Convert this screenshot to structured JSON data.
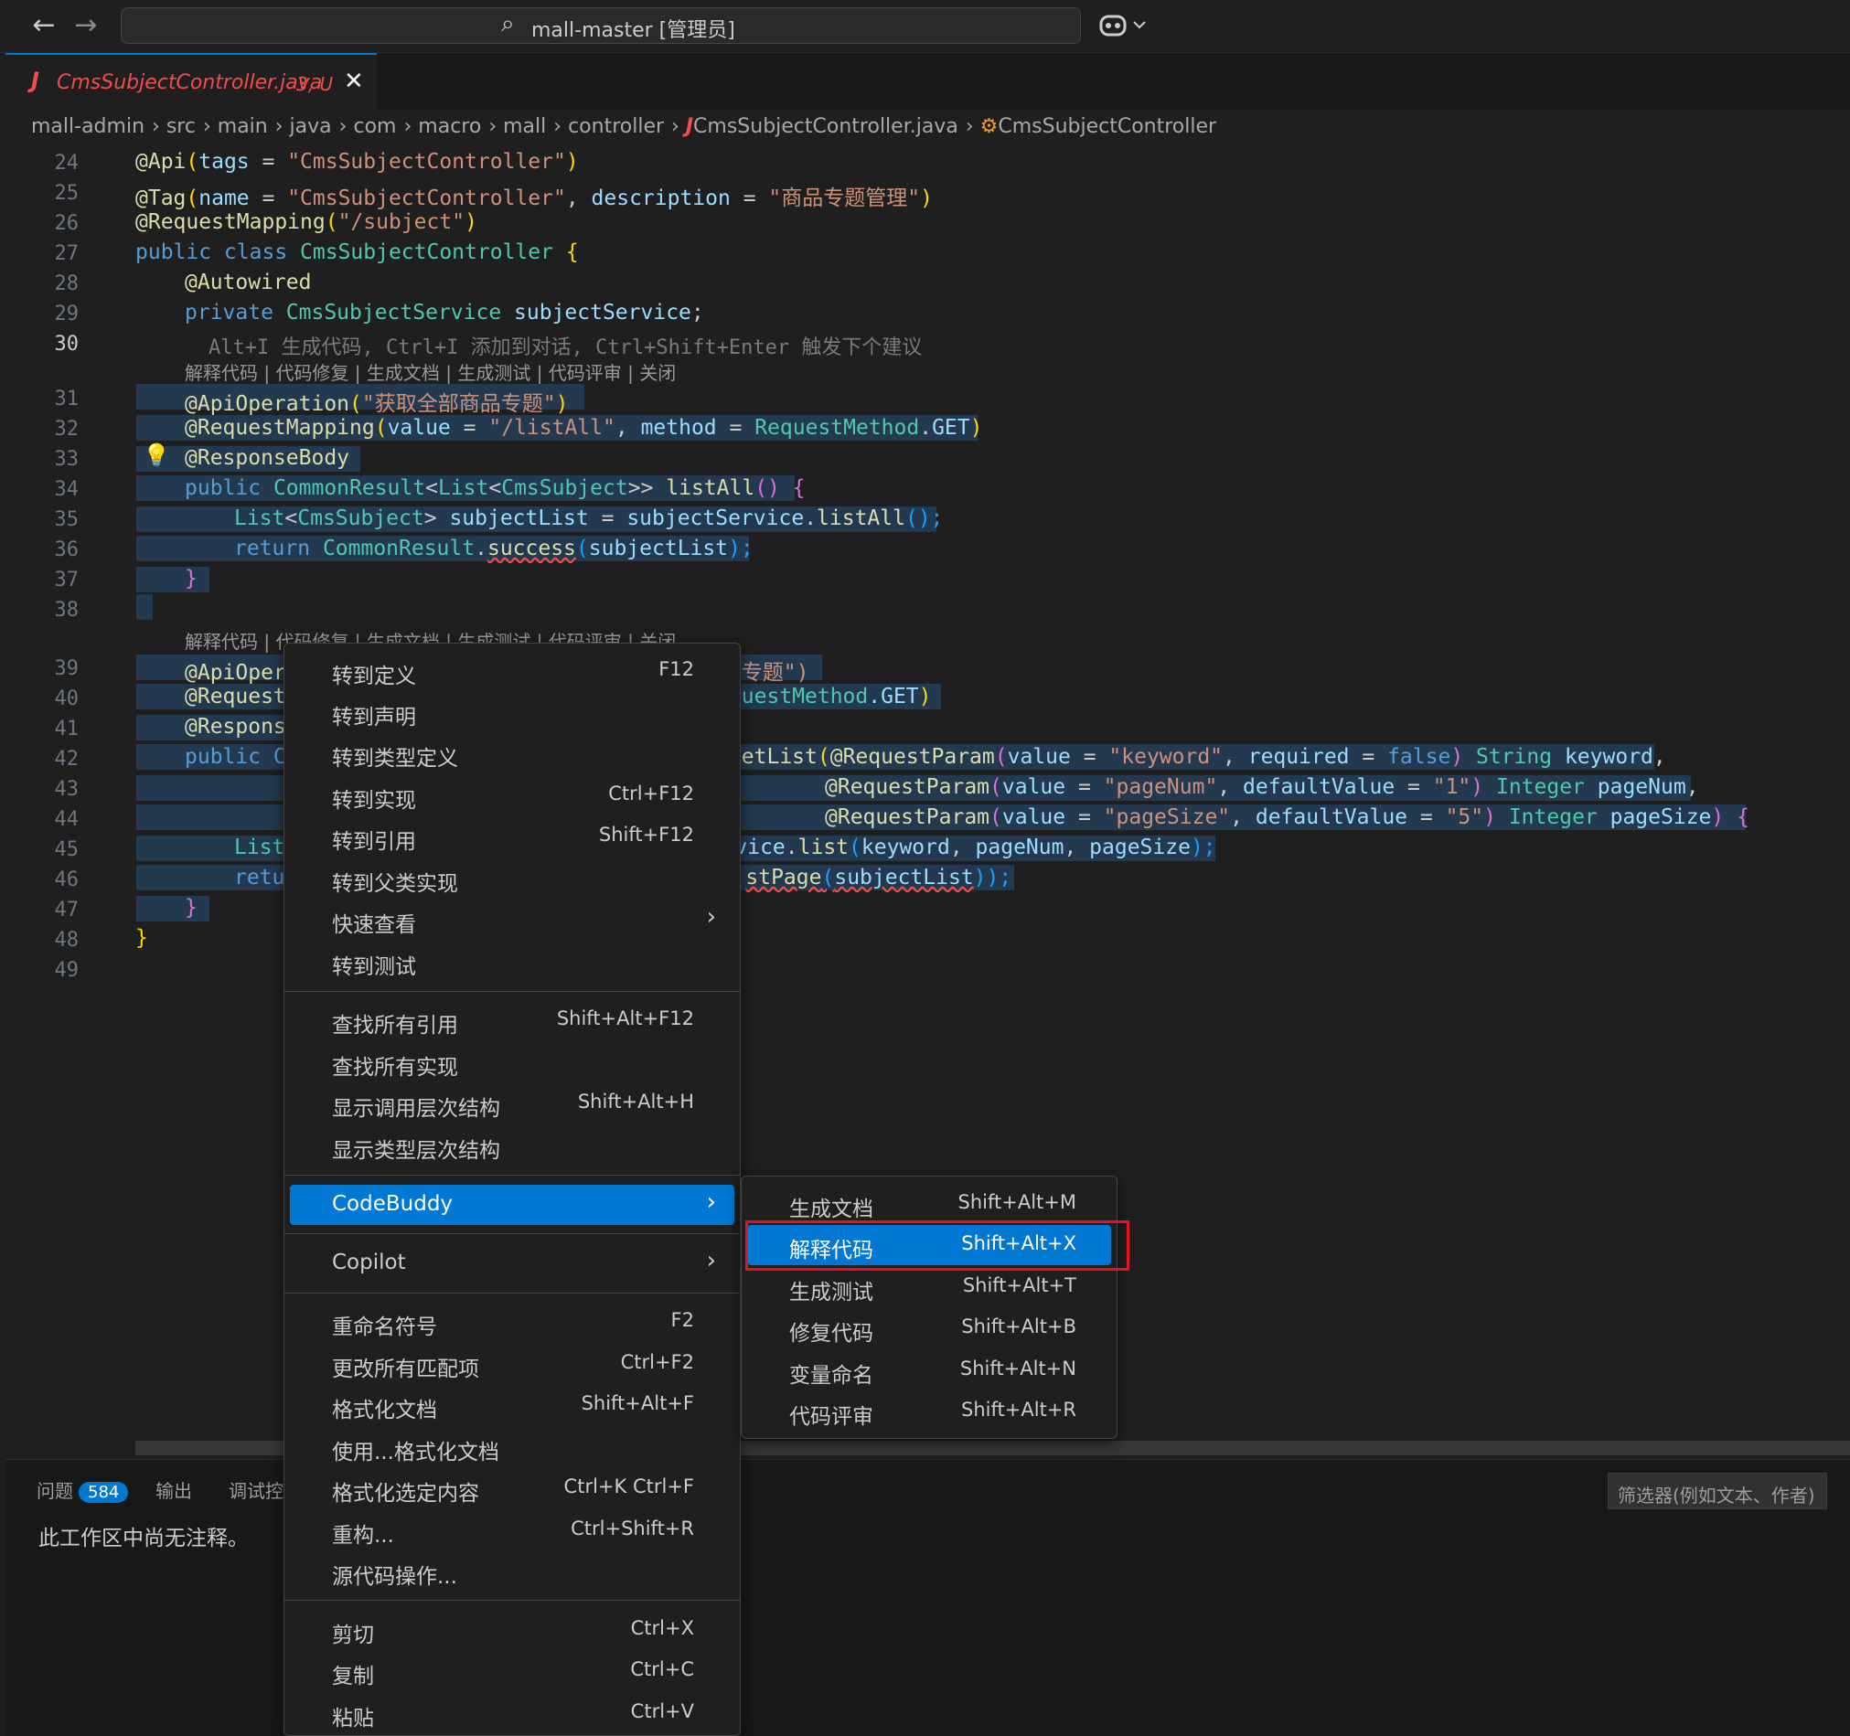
{
  "titlebar": {
    "back_icon": "←",
    "forward_icon": "→",
    "search_icon": "⌕",
    "title": "mall-master [管理员]",
    "copilot_icon": "copilot-icon"
  },
  "tab": {
    "icon": "J",
    "name": "CmsSubjectController.java",
    "status": "3, U",
    "close": "✕"
  },
  "breadcrumb": [
    "mall-admin",
    "src",
    "main",
    "java",
    "com",
    "macro",
    "mall",
    "controller",
    "CmsSubjectController.java",
    "CmsSubjectController"
  ],
  "gutter": [
    "24",
    "25",
    "26",
    "27",
    "28",
    "29",
    "30",
    "31",
    "32",
    "33",
    "34",
    "35",
    "36",
    "37",
    "38",
    "39",
    "40",
    "41",
    "42",
    "43",
    "44",
    "45",
    "46",
    "47",
    "48",
    "49"
  ],
  "code": {
    "l24": [
      "@Api",
      "(",
      "tags",
      " = ",
      "\"CmsSubjectController\"",
      ")"
    ],
    "l25": [
      "@Tag",
      "(",
      "name",
      " = ",
      "\"CmsSubjectController\"",
      ", ",
      "description",
      " = ",
      "\"商品专题管理\"",
      ")"
    ],
    "l26": [
      "@RequestMapping",
      "(",
      "\"/subject\"",
      ")"
    ],
    "l27": [
      "public class ",
      "CmsSubjectController",
      " {"
    ],
    "l28": [
      "@Autowired"
    ],
    "l29": [
      "private ",
      "CmsSubjectService ",
      "subjectService",
      ";"
    ],
    "l30_ghost": "Alt+I 生成代码, Ctrl+I 添加到对话, Ctrl+Shift+Enter 触发下个建议",
    "lens1": "解释代码 | 代码修复 | 生成文档 | 生成测试 | 代码评审 | 关闭",
    "l31": [
      "@ApiOperation",
      "(",
      "\"获取全部商品专题\"",
      ")"
    ],
    "l32": [
      "@RequestMapping",
      "(",
      "value",
      " = ",
      "\"/listAll\"",
      ", ",
      "method",
      " = ",
      "RequestMethod",
      ".",
      "GET",
      ")"
    ],
    "l33": [
      "@ResponseBody"
    ],
    "l34": [
      "public ",
      "CommonResult",
      "<",
      "List",
      "<",
      "CmsSubject",
      ">> ",
      "listAll",
      "() {"
    ],
    "l35": [
      "List",
      "<",
      "CmsSubject",
      "> ",
      "subjectList",
      " = ",
      "subjectService",
      ".",
      "listAll",
      "();"
    ],
    "l36": [
      "return ",
      "CommonResult",
      ".",
      "success",
      "(",
      "subjectList",
      ");"
    ],
    "l37": [
      "}"
    ],
    "lens2": "解释代码 | 代码修复 | 生成文档 | 生成测试 | 代码评审 | 关闭",
    "l39": [
      "@ApiOper",
      "专题\")"
    ],
    "l40": [
      "@Request",
      "uestMethod",
      ".GET",
      ")"
    ],
    "l41": [
      "@Respons"
    ],
    "l42": [
      "public C",
      "etList",
      "(",
      "@RequestParam",
      "(",
      "value",
      " = ",
      "\"keyword\"",
      ", ",
      "required",
      " = ",
      "false",
      ") ",
      "String ",
      "keyword",
      ","
    ],
    "l43": [
      "@RequestParam",
      "(",
      "value",
      " = ",
      "\"pageNum\"",
      ", ",
      "defaultValue",
      " = ",
      "\"1\"",
      ") ",
      "Integer ",
      "pageNum",
      ","
    ],
    "l44": [
      "@RequestParam",
      "(",
      "value",
      " = ",
      "\"pageSize\"",
      ", ",
      "defaultValue",
      " = ",
      "\"5\"",
      ") ",
      "Integer ",
      "pageSize",
      ") {"
    ],
    "l45": [
      "List",
      "vice",
      ".",
      "list",
      "(",
      "keyword",
      ", ",
      "pageNum",
      ", ",
      "pageSize",
      ");"
    ],
    "l46": [
      "retu",
      "stPage",
      "(",
      "subjectList",
      "));"
    ],
    "l47": [
      "}"
    ],
    "l48": [
      "}"
    ]
  },
  "panel": {
    "tab_problems": "问题",
    "problems_count": "584",
    "tab_output": "输出",
    "tab_debug": "调试控",
    "message": "此工作区中尚无注释。",
    "filter_placeholder": "筛选器(例如文本、作者)"
  },
  "context_menu": [
    {
      "label": "转到定义",
      "shortcut": "F12"
    },
    {
      "label": "转到声明",
      "shortcut": ""
    },
    {
      "label": "转到类型定义",
      "shortcut": ""
    },
    {
      "label": "转到实现",
      "shortcut": "Ctrl+F12"
    },
    {
      "label": "转到引用",
      "shortcut": "Shift+F12"
    },
    {
      "label": "转到父类实现",
      "shortcut": ""
    },
    {
      "label": "快速查看",
      "shortcut": "",
      "arrow": "›"
    },
    {
      "label": "转到测试",
      "shortcut": ""
    },
    {
      "label": "查找所有引用",
      "shortcut": "Shift+Alt+F12"
    },
    {
      "label": "查找所有实现",
      "shortcut": ""
    },
    {
      "label": "显示调用层次结构",
      "shortcut": "Shift+Alt+H"
    },
    {
      "label": "显示类型层次结构",
      "shortcut": ""
    },
    {
      "label": "CodeBuddy",
      "shortcut": "",
      "arrow": "›"
    },
    {
      "label": "Copilot",
      "shortcut": "",
      "arrow": "›"
    },
    {
      "label": "重命名符号",
      "shortcut": "F2"
    },
    {
      "label": "更改所有匹配项",
      "shortcut": "Ctrl+F2"
    },
    {
      "label": "格式化文档",
      "shortcut": "Shift+Alt+F"
    },
    {
      "label": "使用...格式化文档",
      "shortcut": ""
    },
    {
      "label": "格式化选定内容",
      "shortcut": "Ctrl+K Ctrl+F"
    },
    {
      "label": "重构...",
      "shortcut": "Ctrl+Shift+R"
    },
    {
      "label": "源代码操作...",
      "shortcut": ""
    },
    {
      "label": "剪切",
      "shortcut": "Ctrl+X"
    },
    {
      "label": "复制",
      "shortcut": "Ctrl+C"
    },
    {
      "label": "粘贴",
      "shortcut": "Ctrl+V"
    }
  ],
  "submenu": [
    {
      "label": "生成文档",
      "shortcut": "Shift+Alt+M"
    },
    {
      "label": "解释代码",
      "shortcut": "Shift+Alt+X"
    },
    {
      "label": "生成测试",
      "shortcut": "Shift+Alt+T"
    },
    {
      "label": "修复代码",
      "shortcut": "Shift+Alt+B"
    },
    {
      "label": "变量命名",
      "shortcut": "Shift+Alt+N"
    },
    {
      "label": "代码评审",
      "shortcut": "Shift+Alt+R"
    }
  ],
  "colors": {
    "accent": "#0078d4",
    "highlight_box": "#e81123",
    "modified_file": "#f14c4c"
  }
}
